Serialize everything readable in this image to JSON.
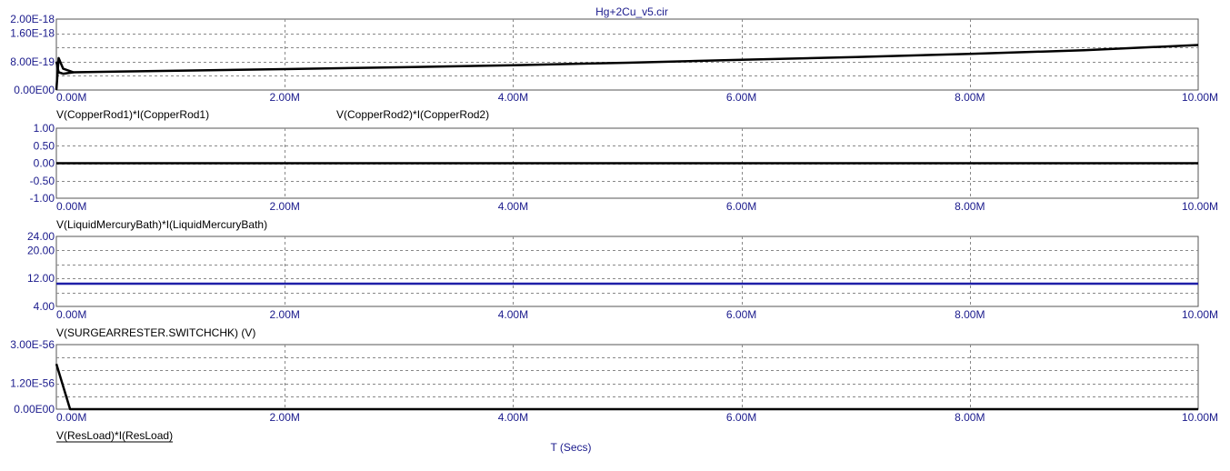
{
  "window": {
    "title": "Hg+2Cu_v5.cir"
  },
  "colors": {
    "axis_text": "#1a1a8c",
    "grid": "#888888",
    "frame": "#555555",
    "trace_black": "#000000",
    "trace_blue": "#1f1fa8"
  },
  "x_axis": {
    "label": "T (Secs)",
    "ticks": [
      "0.00M",
      "2.00M",
      "4.00M",
      "6.00M",
      "8.00M",
      "10.00M"
    ],
    "range": [
      0,
      10
    ]
  },
  "chart_data": [
    {
      "type": "line",
      "y_ticks": [
        "2.00E-18",
        "1.60E-18",
        "8.00E-19",
        "0.00E00"
      ],
      "y_grid_values": [
        0,
        4e-19,
        8e-19,
        1.2e-18,
        1.6e-18,
        2e-18
      ],
      "ylim": [
        0,
        2e-18
      ],
      "trace_labels": [
        "V(CopperRod1)*I(CopperRod1)",
        "V(CopperRod2)*I(CopperRod2)"
      ],
      "series": [
        {
          "color": "#000000",
          "x": [
            0,
            0.02,
            0.06,
            0.15,
            1,
            2,
            3,
            4,
            5,
            6,
            7,
            8,
            9,
            10
          ],
          "y": [
            0,
            9e-19,
            6e-19,
            5e-19,
            5.4e-19,
            5.9e-19,
            6.4e-19,
            7e-19,
            7.7e-19,
            8.5e-19,
            9.3e-19,
            1.02e-18,
            1.12e-18,
            1.27e-18
          ]
        },
        {
          "color": "#000000",
          "x": [
            0,
            0.02,
            0.06,
            0.15
          ],
          "y": [
            8e-19,
            5e-19,
            4.6e-19,
            5e-19
          ]
        }
      ]
    },
    {
      "type": "line",
      "y_ticks": [
        "1.00",
        "0.50",
        "0.00",
        "-0.50",
        "-1.00"
      ],
      "y_grid_values": [
        -1,
        -0.5,
        0,
        0.5,
        1
      ],
      "ylim": [
        -1,
        1
      ],
      "trace_labels": [
        "V(LiquidMercuryBath)*I(LiquidMercuryBath)"
      ],
      "series": [
        {
          "color": "#000000",
          "x": [
            0,
            10
          ],
          "y": [
            0,
            0
          ]
        }
      ]
    },
    {
      "type": "line",
      "y_ticks": [
        "24.00",
        "20.00",
        "12.00",
        "4.00"
      ],
      "y_grid_values": [
        4,
        8,
        12,
        16,
        20,
        24
      ],
      "ylim": [
        4,
        24
      ],
      "trace_labels": [
        "V(SURGEARRESTER.SWITCHCHK) (V)"
      ],
      "series": [
        {
          "color": "#1f1fa8",
          "x": [
            0,
            10
          ],
          "y": [
            10.5,
            10.5
          ]
        }
      ]
    },
    {
      "type": "line",
      "y_ticks": [
        "3.00E-56",
        "1.20E-56",
        "0.00E00"
      ],
      "y_grid_values": [
        0,
        6e-57,
        1.2e-56,
        1.8e-56,
        2.4e-56,
        3e-56
      ],
      "ylim": [
        0,
        3e-56
      ],
      "trace_labels": [
        "V(ResLoad)*I(ResLoad)"
      ],
      "series": [
        {
          "color": "#000000",
          "x": [
            0,
            0.12,
            0.13,
            10
          ],
          "y": [
            2.1e-56,
            0,
            0,
            0
          ]
        }
      ]
    }
  ]
}
